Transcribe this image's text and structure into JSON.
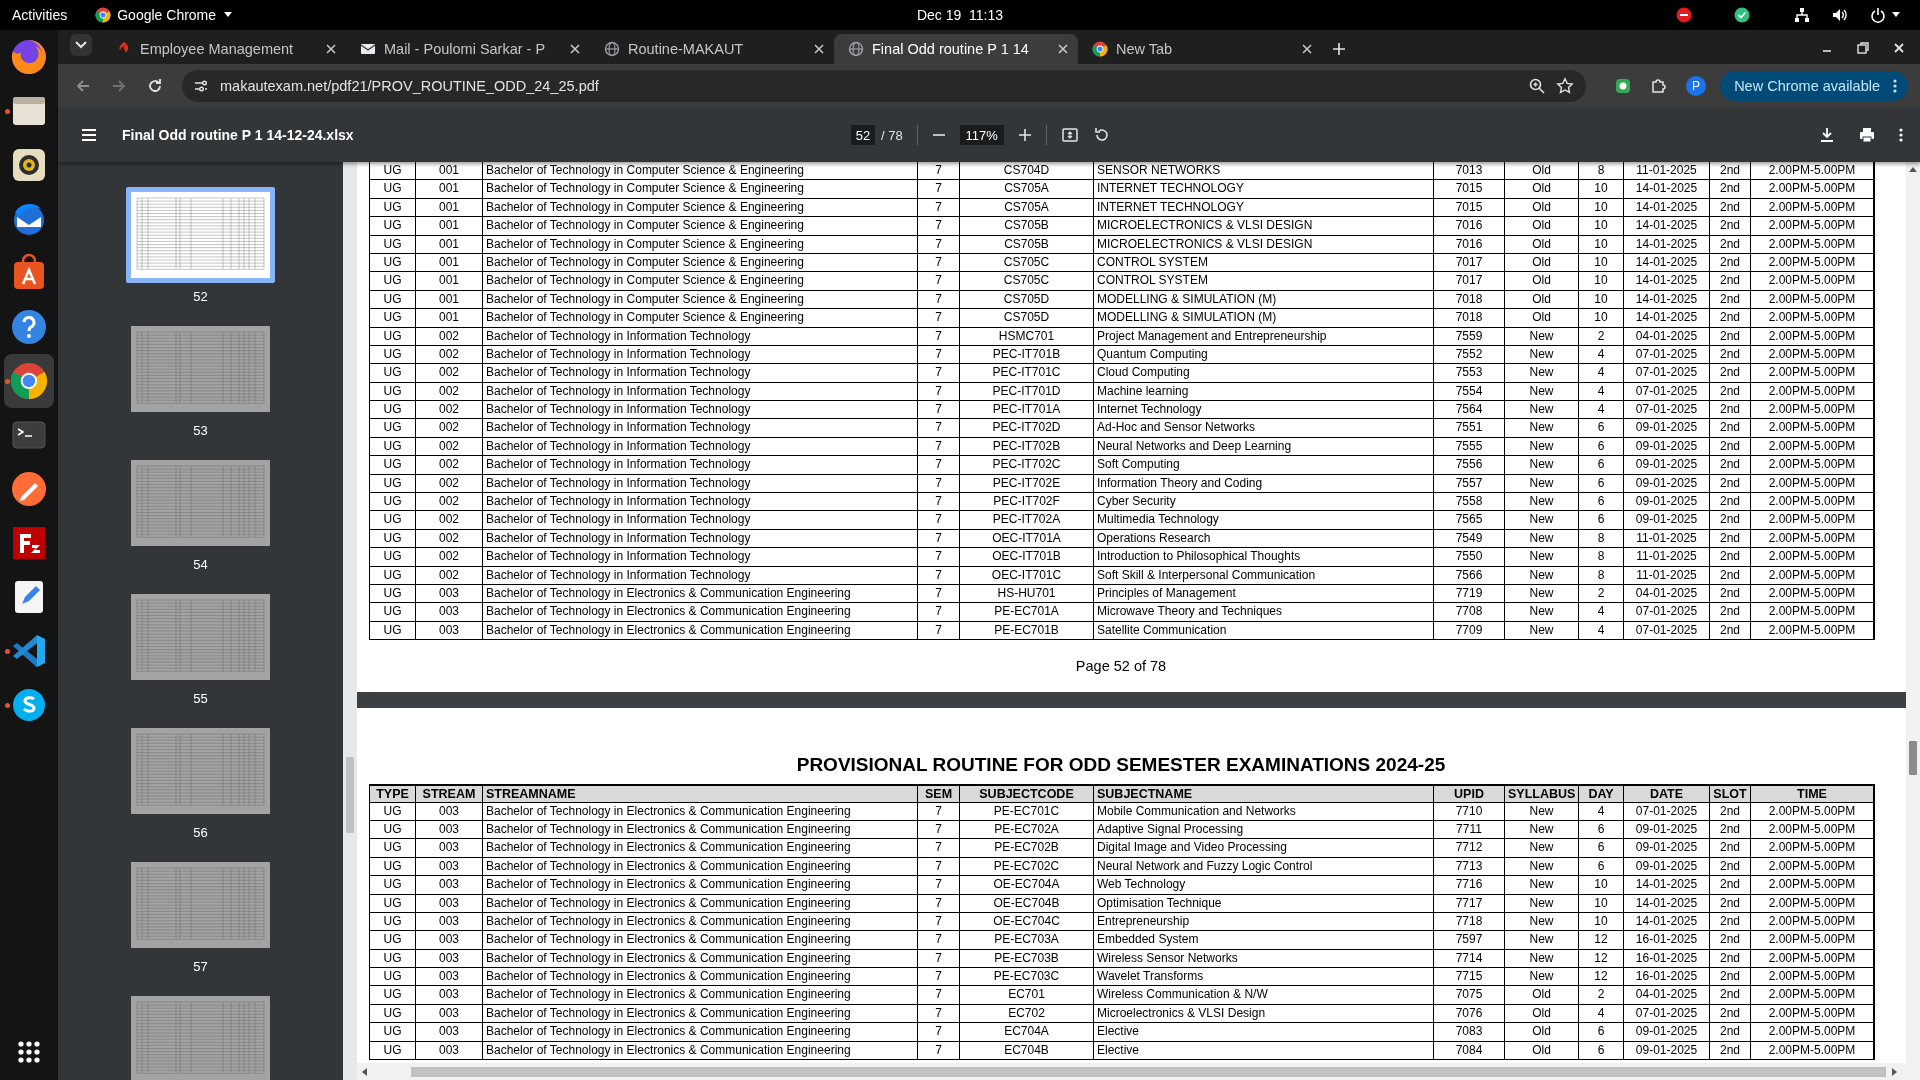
{
  "top_bar": {
    "activities": "Activities",
    "app_name": "Google Chrome",
    "clock": "Dec 19  11:13"
  },
  "dock": [
    {
      "kind": "firefox",
      "running": false,
      "active": false
    },
    {
      "kind": "files",
      "running": true,
      "active": false
    },
    {
      "kind": "rhythmbox",
      "running": false,
      "active": false
    },
    {
      "kind": "thunderbird",
      "running": false,
      "active": false
    },
    {
      "kind": "appcenter",
      "running": false,
      "active": false
    },
    {
      "kind": "help",
      "running": false,
      "active": false
    },
    {
      "kind": "chrome",
      "running": true,
      "active": true
    },
    {
      "kind": "terminal",
      "running": false,
      "active": false
    },
    {
      "kind": "postman",
      "running": false,
      "active": false
    },
    {
      "kind": "filezilla",
      "running": false,
      "active": false
    },
    {
      "kind": "editor",
      "running": false,
      "active": false
    },
    {
      "kind": "vscode",
      "running": true,
      "active": false
    },
    {
      "kind": "skype",
      "running": true,
      "active": false
    }
  ],
  "tabs": [
    {
      "title": "Employee Management",
      "kind": "app",
      "selected": false
    },
    {
      "title": "Mail - Poulomi Sarkar - P",
      "kind": "mail",
      "selected": false
    },
    {
      "title": "Routine-MAKAUT",
      "kind": "globe",
      "selected": false
    },
    {
      "title": "Final Odd routine P 1 14",
      "kind": "globe",
      "selected": true
    },
    {
      "title": "New Tab",
      "kind": "chrome",
      "selected": false
    }
  ],
  "address_bar": {
    "url": "makautexam.net/pdf21/PROV_ROUTINE_ODD_24_25.pdf",
    "profile": "P",
    "update_button": "New Chrome available"
  },
  "pdf_toolbar": {
    "title": "Final Odd routine P 1 14-12-24.xlsx",
    "page": "52",
    "page_count": "/ 78",
    "zoom": "117%"
  },
  "thumbnails": [
    {
      "label": "52",
      "selected": true
    },
    {
      "label": "53",
      "selected": false
    },
    {
      "label": "54",
      "selected": false
    },
    {
      "label": "55",
      "selected": false
    },
    {
      "label": "56",
      "selected": false
    },
    {
      "label": "57",
      "selected": false
    },
    {
      "selected": false
    }
  ],
  "pages": [
    {
      "rows": [
        [
          "UG",
          "001",
          "Bachelor of Technology in Computer Science & Engineering",
          "7",
          "CS704D",
          "SENSOR NETWORKS",
          "7013",
          "Old",
          "8",
          "11-01-2025",
          "2nd",
          "2.00PM-5.00PM"
        ],
        [
          "UG",
          "001",
          "Bachelor of Technology in Computer Science & Engineering",
          "7",
          "CS705A",
          "INTERNET TECHNOLOGY",
          "7015",
          "Old",
          "10",
          "14-01-2025",
          "2nd",
          "2.00PM-5.00PM"
        ],
        [
          "UG",
          "001",
          "Bachelor of Technology in Computer Science & Engineering",
          "7",
          "CS705A",
          "INTERNET TECHNOLOGY",
          "7015",
          "Old",
          "10",
          "14-01-2025",
          "2nd",
          "2.00PM-5.00PM"
        ],
        [
          "UG",
          "001",
          "Bachelor of Technology in Computer Science & Engineering",
          "7",
          "CS705B",
          "MICROELECTRONICS & VLSI DESIGN",
          "7016",
          "Old",
          "10",
          "14-01-2025",
          "2nd",
          "2.00PM-5.00PM"
        ],
        [
          "UG",
          "001",
          "Bachelor of Technology in Computer Science & Engineering",
          "7",
          "CS705B",
          "MICROELECTRONICS & VLSI DESIGN",
          "7016",
          "Old",
          "10",
          "14-01-2025",
          "2nd",
          "2.00PM-5.00PM"
        ],
        [
          "UG",
          "001",
          "Bachelor of Technology in Computer Science & Engineering",
          "7",
          "CS705C",
          "CONTROL SYSTEM",
          "7017",
          "Old",
          "10",
          "14-01-2025",
          "2nd",
          "2.00PM-5.00PM"
        ],
        [
          "UG",
          "001",
          "Bachelor of Technology in Computer Science & Engineering",
          "7",
          "CS705C",
          "CONTROL SYSTEM",
          "7017",
          "Old",
          "10",
          "14-01-2025",
          "2nd",
          "2.00PM-5.00PM"
        ],
        [
          "UG",
          "001",
          "Bachelor of Technology in Computer Science & Engineering",
          "7",
          "CS705D",
          "MODELLING & SIMULATION (M)",
          "7018",
          "Old",
          "10",
          "14-01-2025",
          "2nd",
          "2.00PM-5.00PM"
        ],
        [
          "UG",
          "001",
          "Bachelor of Technology in Computer Science & Engineering",
          "7",
          "CS705D",
          "MODELLING & SIMULATION (M)",
          "7018",
          "Old",
          "10",
          "14-01-2025",
          "2nd",
          "2.00PM-5.00PM"
        ],
        [
          "UG",
          "002",
          "Bachelor of Technology in Information Technology",
          "7",
          "HSMC701",
          "Project Management and Entrepreneurship",
          "7559",
          "New",
          "2",
          "04-01-2025",
          "2nd",
          "2.00PM-5.00PM"
        ],
        [
          "UG",
          "002",
          "Bachelor of Technology in Information Technology",
          "7",
          "PEC-IT701B",
          "Quantum Computing",
          "7552",
          "New",
          "4",
          "07-01-2025",
          "2nd",
          "2.00PM-5.00PM"
        ],
        [
          "UG",
          "002",
          "Bachelor of Technology in Information Technology",
          "7",
          "PEC-IT701C",
          "Cloud Computing",
          "7553",
          "New",
          "4",
          "07-01-2025",
          "2nd",
          "2.00PM-5.00PM"
        ],
        [
          "UG",
          "002",
          "Bachelor of Technology in Information Technology",
          "7",
          "PEC-IT701D",
          "Machine learning",
          "7554",
          "New",
          "4",
          "07-01-2025",
          "2nd",
          "2.00PM-5.00PM"
        ],
        [
          "UG",
          "002",
          "Bachelor of Technology in Information Technology",
          "7",
          "PEC-IT701A",
          "Internet Technology",
          "7564",
          "New",
          "4",
          "07-01-2025",
          "2nd",
          "2.00PM-5.00PM"
        ],
        [
          "UG",
          "002",
          "Bachelor of Technology in Information Technology",
          "7",
          "PEC-IT702D",
          "Ad-Hoc and Sensor Networks",
          "7551",
          "New",
          "6",
          "09-01-2025",
          "2nd",
          "2.00PM-5.00PM"
        ],
        [
          "UG",
          "002",
          "Bachelor of Technology in Information Technology",
          "7",
          "PEC-IT702B",
          "Neural Networks and Deep Learning",
          "7555",
          "New",
          "6",
          "09-01-2025",
          "2nd",
          "2.00PM-5.00PM"
        ],
        [
          "UG",
          "002",
          "Bachelor of Technology in Information Technology",
          "7",
          "PEC-IT702C",
          "Soft Computing",
          "7556",
          "New",
          "6",
          "09-01-2025",
          "2nd",
          "2.00PM-5.00PM"
        ],
        [
          "UG",
          "002",
          "Bachelor of Technology in Information Technology",
          "7",
          "PEC-IT702E",
          "Information Theory and Coding",
          "7557",
          "New",
          "6",
          "09-01-2025",
          "2nd",
          "2.00PM-5.00PM"
        ],
        [
          "UG",
          "002",
          "Bachelor of Technology in Information Technology",
          "7",
          "PEC-IT702F",
          "Cyber Security",
          "7558",
          "New",
          "6",
          "09-01-2025",
          "2nd",
          "2.00PM-5.00PM"
        ],
        [
          "UG",
          "002",
          "Bachelor of Technology in Information Technology",
          "7",
          "PEC-IT702A",
          "Multimedia Technology",
          "7565",
          "New",
          "6",
          "09-01-2025",
          "2nd",
          "2.00PM-5.00PM"
        ],
        [
          "UG",
          "002",
          "Bachelor of Technology in Information Technology",
          "7",
          "OEC-IT701A",
          "Operations Research",
          "7549",
          "New",
          "8",
          "11-01-2025",
          "2nd",
          "2.00PM-5.00PM"
        ],
        [
          "UG",
          "002",
          "Bachelor of Technology in Information Technology",
          "7",
          "OEC-IT701B",
          "Introduction to Philosophical Thoughts",
          "7550",
          "New",
          "8",
          "11-01-2025",
          "2nd",
          "2.00PM-5.00PM"
        ],
        [
          "UG",
          "002",
          "Bachelor of Technology in Information Technology",
          "7",
          "OEC-IT701C",
          "Soft Skill & Interpersonal Communication",
          "7566",
          "New",
          "8",
          "11-01-2025",
          "2nd",
          "2.00PM-5.00PM"
        ],
        [
          "UG",
          "003",
          "Bachelor of Technology in Electronics & Communication Engineering",
          "7",
          "HS-HU701",
          "Principles of Management",
          "7719",
          "New",
          "2",
          "04-01-2025",
          "2nd",
          "2.00PM-5.00PM"
        ],
        [
          "UG",
          "003",
          "Bachelor of Technology in Electronics & Communication Engineering",
          "7",
          "PE-EC701A",
          "Microwave Theory and Techniques",
          "7708",
          "New",
          "4",
          "07-01-2025",
          "2nd",
          "2.00PM-5.00PM"
        ],
        [
          "UG",
          "003",
          "Bachelor of Technology in Electronics & Communication Engineering",
          "7",
          "PE-EC701B",
          "Satellite Communication",
          "7709",
          "New",
          "4",
          "07-01-2025",
          "2nd",
          "2.00PM-5.00PM"
        ]
      ],
      "footer": "Page 52 of 78"
    },
    {
      "title": "PROVISIONAL ROUTINE FOR ODD SEMESTER EXAMINATIONS 2024-25",
      "columns": [
        "TYPE",
        "STREAM",
        "STREAMNAME",
        "SEM",
        "SUBJECTCODE",
        "SUBJECTNAME",
        "UPID",
        "SYLLABUS",
        "DAY",
        "DATE",
        "SLOT",
        "TIME"
      ],
      "rows": [
        [
          "UG",
          "003",
          "Bachelor of Technology in Electronics & Communication Engineering",
          "7",
          "PE-EC701C",
          "Mobile Communication and Networks",
          "7710",
          "New",
          "4",
          "07-01-2025",
          "2nd",
          "2.00PM-5.00PM"
        ],
        [
          "UG",
          "003",
          "Bachelor of Technology in Electronics & Communication Engineering",
          "7",
          "PE-EC702A",
          "Adaptive Signal Processing",
          "7711",
          "New",
          "6",
          "09-01-2025",
          "2nd",
          "2.00PM-5.00PM"
        ],
        [
          "UG",
          "003",
          "Bachelor of Technology in Electronics & Communication Engineering",
          "7",
          "PE-EC702B",
          "Digital Image and Video Processing",
          "7712",
          "New",
          "6",
          "09-01-2025",
          "2nd",
          "2.00PM-5.00PM"
        ],
        [
          "UG",
          "003",
          "Bachelor of Technology in Electronics & Communication Engineering",
          "7",
          "PE-EC702C",
          "Neural Network and Fuzzy Logic Control",
          "7713",
          "New",
          "6",
          "09-01-2025",
          "2nd",
          "2.00PM-5.00PM"
        ],
        [
          "UG",
          "003",
          "Bachelor of Technology in Electronics & Communication Engineering",
          "7",
          "OE-EC704A",
          "Web Technology",
          "7716",
          "New",
          "10",
          "14-01-2025",
          "2nd",
          "2.00PM-5.00PM"
        ],
        [
          "UG",
          "003",
          "Bachelor of Technology in Electronics & Communication Engineering",
          "7",
          "OE-EC704B",
          "Optimisation Technique",
          "7717",
          "New",
          "10",
          "14-01-2025",
          "2nd",
          "2.00PM-5.00PM"
        ],
        [
          "UG",
          "003",
          "Bachelor of Technology in Electronics & Communication Engineering",
          "7",
          "OE-EC704C",
          "Entrepreneurship",
          "7718",
          "New",
          "10",
          "14-01-2025",
          "2nd",
          "2.00PM-5.00PM"
        ],
        [
          "UG",
          "003",
          "Bachelor of Technology in Electronics & Communication Engineering",
          "7",
          "PE-EC703A",
          "Embedded System",
          "7597",
          "New",
          "12",
          "16-01-2025",
          "2nd",
          "2.00PM-5.00PM"
        ],
        [
          "UG",
          "003",
          "Bachelor of Technology in Electronics & Communication Engineering",
          "7",
          "PE-EC703B",
          "Wireless Sensor Networks",
          "7714",
          "New",
          "12",
          "16-01-2025",
          "2nd",
          "2.00PM-5.00PM"
        ],
        [
          "UG",
          "003",
          "Bachelor of Technology in Electronics & Communication Engineering",
          "7",
          "PE-EC703C",
          "Wavelet Transforms",
          "7715",
          "New",
          "12",
          "16-01-2025",
          "2nd",
          "2.00PM-5.00PM"
        ],
        [
          "UG",
          "003",
          "Bachelor of Technology in Electronics & Communication Engineering",
          "7",
          "EC701",
          "Wireless Communication & N/W",
          "7075",
          "Old",
          "2",
          "04-01-2025",
          "2nd",
          "2.00PM-5.00PM"
        ],
        [
          "UG",
          "003",
          "Bachelor of Technology in Electronics & Communication Engineering",
          "7",
          "EC702",
          "Microelectronics & VLSI Design",
          "7076",
          "Old",
          "4",
          "07-01-2025",
          "2nd",
          "2.00PM-5.00PM"
        ],
        [
          "UG",
          "003",
          "Bachelor of Technology in Electronics & Communication Engineering",
          "7",
          "EC704A",
          "Elective",
          "7083",
          "Old",
          "6",
          "09-01-2025",
          "2nd",
          "2.00PM-5.00PM"
        ],
        [
          "UG",
          "003",
          "Bachelor of Technology in Electronics & Communication Engineering",
          "7",
          "EC704B",
          "Elective",
          "7084",
          "Old",
          "6",
          "09-01-2025",
          "2nd",
          "2.00PM-5.00PM"
        ]
      ]
    }
  ]
}
